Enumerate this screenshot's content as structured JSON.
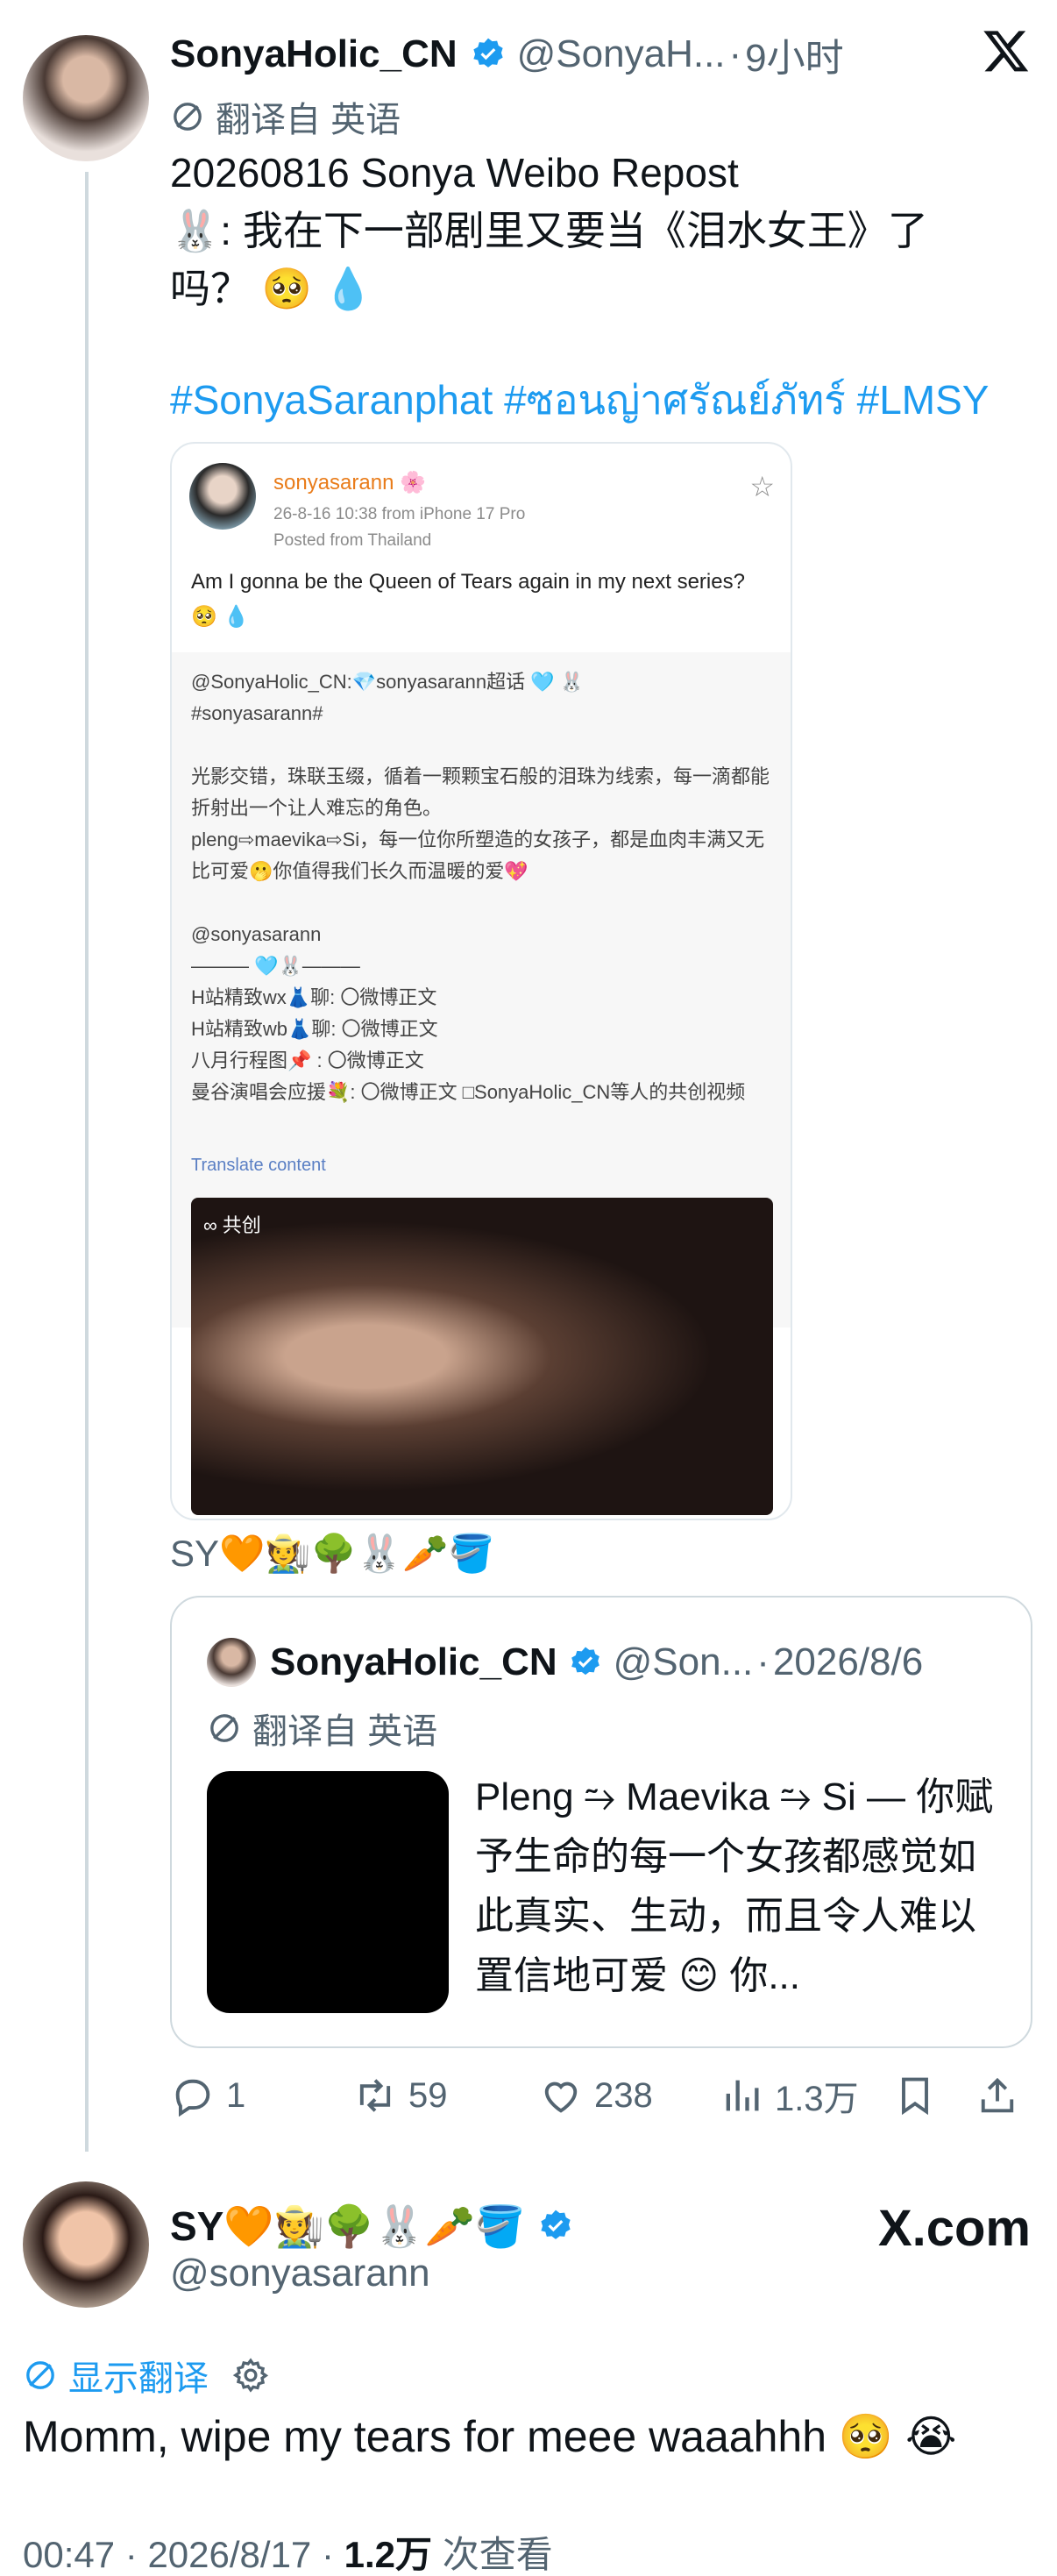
{
  "main_tweet": {
    "display_name": "SonyaHolic_CN",
    "handle": "@SonyaH...",
    "time": "9小时",
    "translated_from": "翻译自 英语",
    "text_line1": "20260816 Sonya Weibo Repost",
    "text_line2": "🐰: 我在下一部剧里又要当《泪水女王》了",
    "text_line3": "吗？ 🥺 💧",
    "hashtags": "#SonyaSaranphat #ซอนญ่าศรัณย์ภัทร์ #LMSY"
  },
  "weibo_card": {
    "name": "sonyasarann 🌸",
    "meta_line1": "26-8-16 10:38  from iPhone 17 Pro",
    "meta_line2": "Posted from Thailand",
    "text": "Am I gonna be the Queen of Tears again in my next series? 🥺 💧",
    "repost_text": "@SonyaHolic_CN:💎sonyasarann超话 🩵 🐰\n#sonyasarann#\n\n光影交错，珠联玉缀，循着一颗颗宝石般的泪珠为线索，每一滴都能折射出一个让人难忘的角色。\npleng⇨maevika⇨Si，每一位你所塑造的女孩子，都是血肉丰满又无比可爱🫢你值得我们长久而温暖的爱💖\n\n @sonyasarann\n——— 🩵🐰———\nH站精致wx👗聊: 〇微博正文\nH站精致wb👗聊: 〇微博正文\n八月行程图📌 : 〇微博正文\n曼谷演唱会应援💐: 〇微博正文 □SonyaHolic_CN等人的共创视频",
    "translate": "Translate content",
    "video_badge": "共创"
  },
  "sy_line": "SY🧡🧑‍🌾🌳🐰🥕🪣",
  "quote": {
    "display_name": "SonyaHolic_CN",
    "handle": "@Son...",
    "date": "2026/8/6",
    "translated_from": "翻译自 英语",
    "text": "Pleng ⥲ Maevika ⥲ Si — 你赋予生命的每一个女孩都感觉如此真实、生动，而且令人难以置信地可爱 😊 你..."
  },
  "actions": {
    "replies": "1",
    "reposts": "59",
    "likes": "238",
    "views": "1.3万"
  },
  "reply": {
    "display_name": "SY🧡🧑‍🌾🌳🐰🥕🪣",
    "handle": "@sonyasarann",
    "brand": "X.com",
    "show_translation": "显示翻译",
    "text": "Momm, wipe my tears for meee waaahhh 🥺 😭",
    "time": "00:47",
    "date": "2026/8/17",
    "views_count": "1.2万",
    "views_label": "次查看"
  },
  "colors": {
    "accent": "#1d9bf0",
    "secondary_text": "#536471",
    "weibo_orange": "#e97c1a"
  }
}
